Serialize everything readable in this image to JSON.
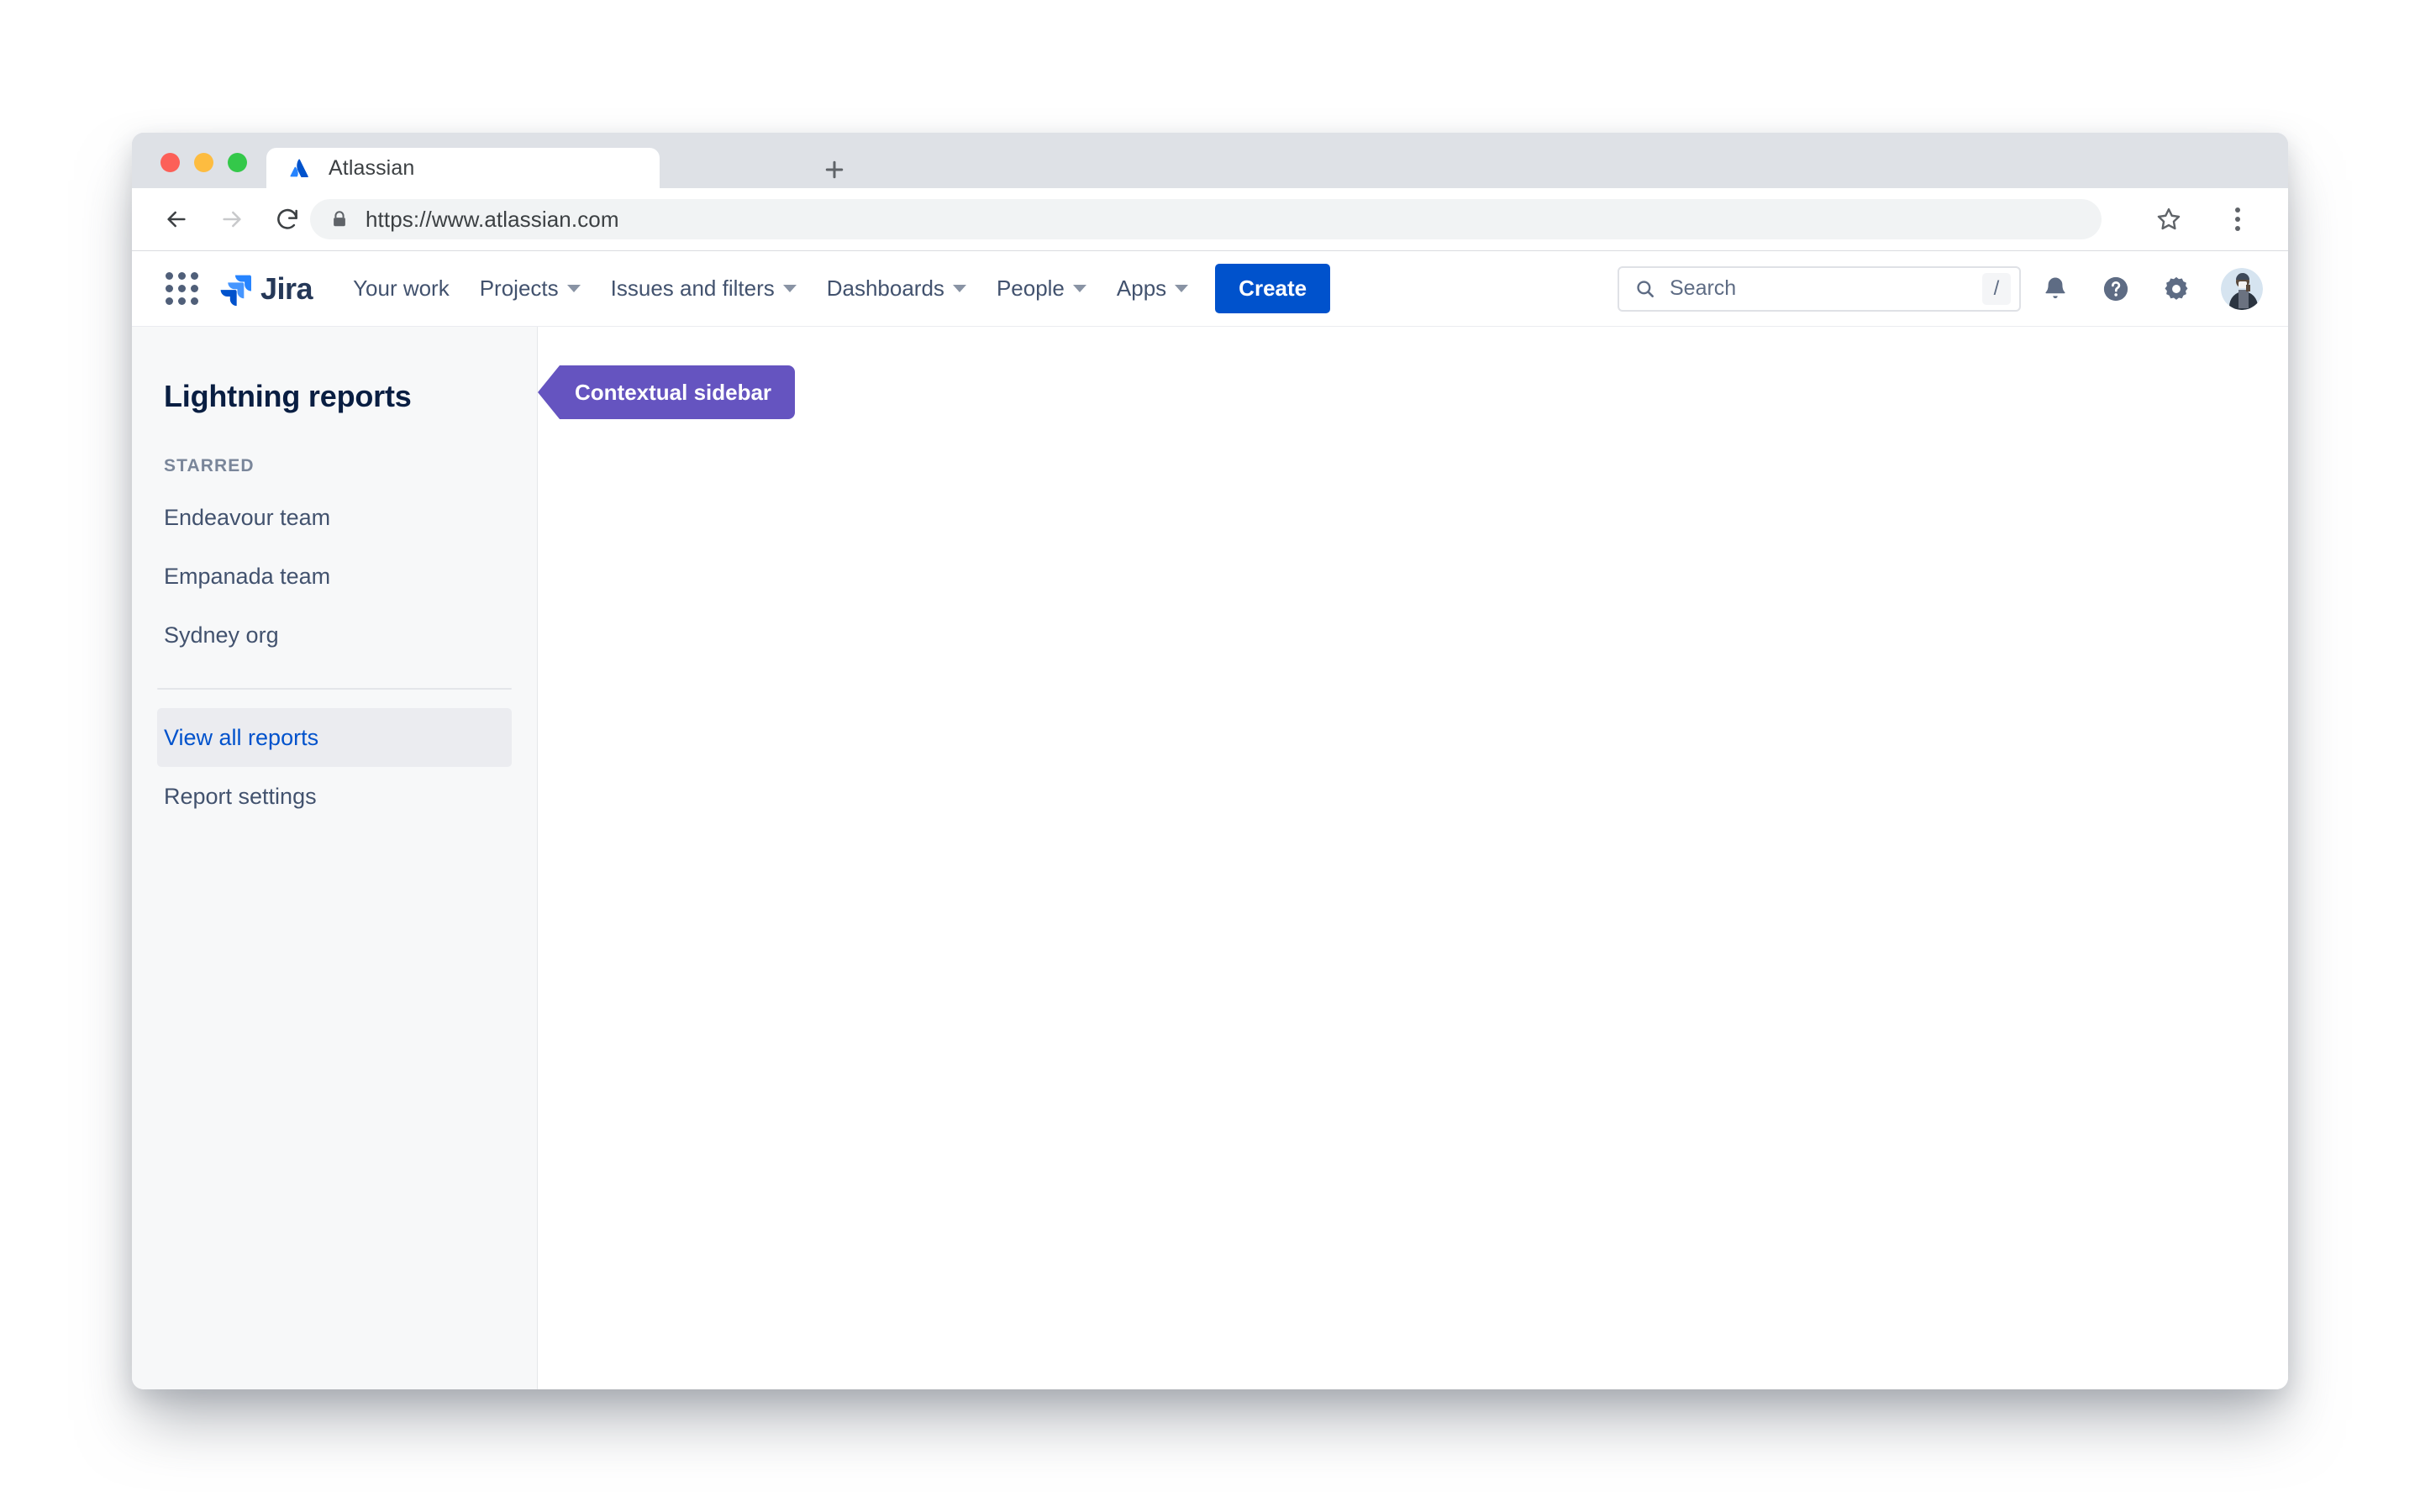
{
  "browser": {
    "traffic_lights": [
      "close",
      "minimize",
      "zoom"
    ],
    "tab": {
      "title": "Atlassian",
      "favicon": "atlassian-icon"
    },
    "new_tab_label": "+",
    "url": "https://www.atlassian.com",
    "url_secure": true,
    "back_label": "Back",
    "forward_label": "Forward",
    "reload_label": "Reload",
    "bookmark_label": "Bookmark this page",
    "menu_label": "Customize and control"
  },
  "topnav": {
    "app_switcher": "app-switcher-icon",
    "product_name": "Jira",
    "items": [
      {
        "label": "Your work",
        "has_caret": false
      },
      {
        "label": "Projects",
        "has_caret": true
      },
      {
        "label": "Issues and filters",
        "has_caret": true
      },
      {
        "label": "Dashboards",
        "has_caret": true
      },
      {
        "label": "People",
        "has_caret": true
      },
      {
        "label": "Apps",
        "has_caret": true
      }
    ],
    "create_label": "Create",
    "create_color": "#0052cc",
    "search": {
      "placeholder": "Search",
      "value": "",
      "shortcut": "/"
    },
    "notifications_label": "Notifications",
    "help_label": "Help",
    "settings_label": "Settings",
    "avatar_label": "Your profile and settings"
  },
  "sidebar": {
    "title": "Lightning reports",
    "section_label": "STARRED",
    "starred": [
      {
        "label": "Endeavour team",
        "active": false
      },
      {
        "label": "Empanada team",
        "active": false
      },
      {
        "label": "Sydney org",
        "active": false
      }
    ],
    "footer_items": [
      {
        "label": "View all reports",
        "active": true
      },
      {
        "label": "Report settings",
        "active": false
      }
    ],
    "background": "#f7f8f9"
  },
  "callout": {
    "label": "Contextual sidebar",
    "color": "#6554c0"
  }
}
